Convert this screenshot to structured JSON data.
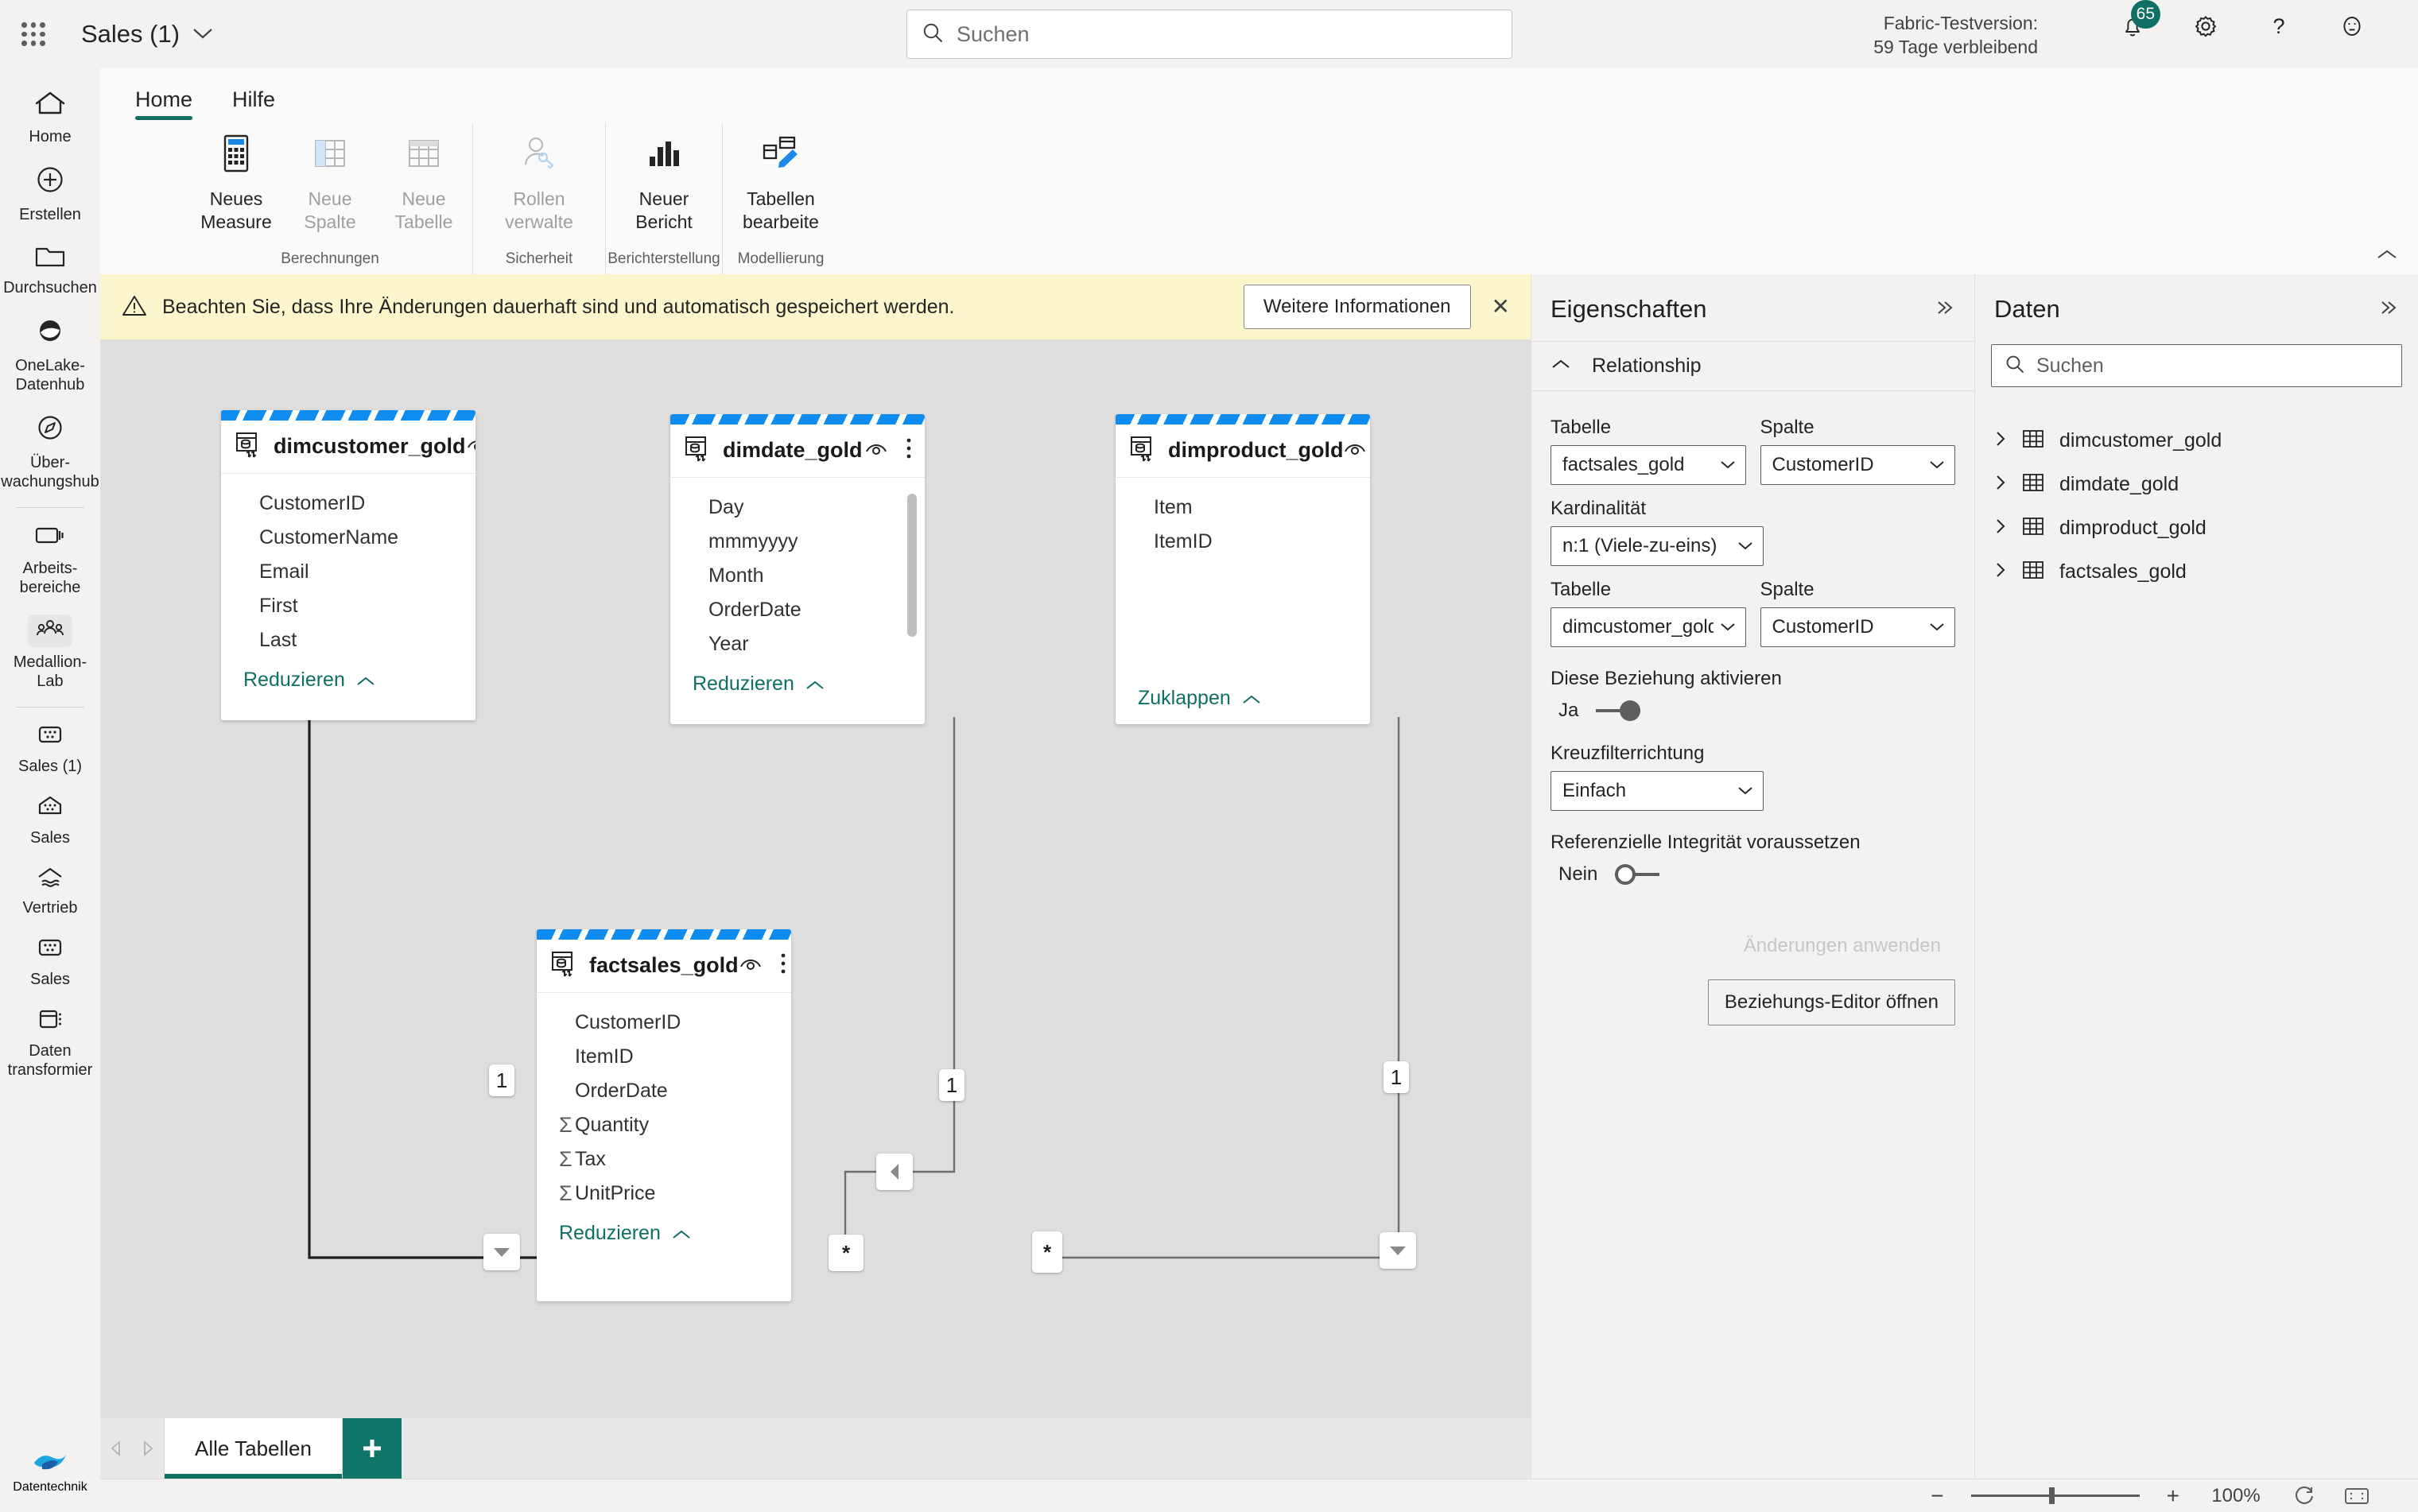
{
  "topbar": {
    "app_title": "Sales (1)",
    "waffle_icon": "app-launcher-icon",
    "title_chevron": "chevron-down-icon",
    "search": {
      "placeholder": "Suchen",
      "value": "",
      "icon": "search-icon"
    },
    "trial_line1": "Fabric-Testversion:",
    "trial_line2": "59 Tage verbleibend",
    "notifications": {
      "icon": "bell-icon",
      "badge": "65"
    },
    "settings_icon": "gear-icon",
    "help_icon": "question-mark-icon",
    "feedback_icon": "smiley-face-icon"
  },
  "sidebar": {
    "items": [
      {
        "label": "Home",
        "icon": "home-icon"
      },
      {
        "label": "Erstellen",
        "icon": "plus-circle-icon"
      },
      {
        "label": "Durchsuchen",
        "icon": "folder-icon"
      },
      {
        "label": "OneLake-\nDatenhub",
        "icon": "onelake-icon"
      },
      {
        "label": "Über-\nwachungshub",
        "icon": "compass-icon"
      },
      {
        "label": "Arbeits-\nbereiche",
        "icon": "workspaces-icon"
      },
      {
        "label": "Medallion-\nLab",
        "icon": "people-group-icon"
      },
      {
        "label": "Sales (1)",
        "icon": "semantic-model-icon"
      },
      {
        "label": "Sales",
        "icon": "lakehouse-icon"
      },
      {
        "label": "Vertrieb",
        "icon": "warehouse-icon"
      },
      {
        "label": "Sales",
        "icon": "semantic-model-icon"
      },
      {
        "label": "Daten\ntransformier",
        "icon": "dataflow-icon"
      }
    ],
    "bottom": {
      "label": "Datentechnik",
      "icon": "data-engineering-icon"
    }
  },
  "ribbon": {
    "tabs": [
      {
        "label": "Home",
        "active": true
      },
      {
        "label": "Hilfe",
        "active": false
      }
    ],
    "groups": [
      {
        "label": "Berechnungen",
        "buttons": [
          {
            "label": "Neues\nMeasure",
            "icon": "new-measure-icon",
            "disabled": false
          },
          {
            "label": "Neue\nSpalte",
            "icon": "new-column-icon",
            "disabled": true
          },
          {
            "label": "Neue\nTabelle",
            "icon": "new-table-icon",
            "disabled": true
          }
        ]
      },
      {
        "label": "Sicherheit",
        "buttons": [
          {
            "label": "Rollen\nverwalte",
            "icon": "manage-roles-icon",
            "disabled": true
          }
        ]
      },
      {
        "label": "Berichterstellung",
        "buttons": [
          {
            "label": "Neuer\nBericht",
            "icon": "new-report-icon",
            "disabled": false
          }
        ]
      },
      {
        "label": "Modellierung",
        "buttons": [
          {
            "label": "Tabellen\nbearbeite",
            "icon": "edit-tables-icon",
            "disabled": false
          }
        ]
      }
    ],
    "collapse_icon": "chevron-up-icon"
  },
  "banner": {
    "icon": "warning-triangle-icon",
    "text": "Beachten Sie, dass Ihre Änderungen dauerhaft sind und automatisch gespeichert werden.",
    "button": "Weitere Informationen",
    "close_icon": "close-icon"
  },
  "canvas": {
    "tables": [
      {
        "name": "dimcustomer_gold",
        "icon": "table-sync-icon",
        "eye_icon": "eye-icon",
        "more_icon": "more-vertical-icon",
        "fields": [
          {
            "name": "CustomerID",
            "agg": false
          },
          {
            "name": "CustomerName",
            "agg": false
          },
          {
            "name": "Email",
            "agg": false
          },
          {
            "name": "First",
            "agg": false
          },
          {
            "name": "Last",
            "agg": false
          }
        ],
        "collapse_label": "Reduzieren",
        "collapse_icon": "chevron-up-icon",
        "scrollbar": false
      },
      {
        "name": "dimdate_gold",
        "icon": "table-sync-icon",
        "eye_icon": "eye-icon",
        "more_icon": "more-vertical-icon",
        "fields": [
          {
            "name": "Day",
            "agg": false
          },
          {
            "name": "mmmyyyy",
            "agg": false
          },
          {
            "name": "Month",
            "agg": false
          },
          {
            "name": "OrderDate",
            "agg": false
          },
          {
            "name": "Year",
            "agg": false
          }
        ],
        "collapse_label": "Reduzieren",
        "collapse_icon": "chevron-up-icon",
        "scrollbar": true
      },
      {
        "name": "dimproduct_gold",
        "icon": "table-sync-icon",
        "eye_icon": "eye-icon",
        "more_icon": "more-vertical-icon",
        "fields": [
          {
            "name": "Item",
            "agg": false
          },
          {
            "name": "ItemID",
            "agg": false
          }
        ],
        "collapse_label": "Zuklappen",
        "collapse_icon": "chevron-up-icon",
        "scrollbar": false
      },
      {
        "name": "factsales_gold",
        "icon": "table-sync-icon",
        "eye_icon": "eye-icon",
        "more_icon": "more-vertical-icon",
        "fields": [
          {
            "name": "CustomerID",
            "agg": false
          },
          {
            "name": "ItemID",
            "agg": false
          },
          {
            "name": "OrderDate",
            "agg": false
          },
          {
            "name": "Quantity",
            "agg": true
          },
          {
            "name": "Tax",
            "agg": true
          },
          {
            "name": "UnitPrice",
            "agg": true
          }
        ],
        "collapse_label": "Reduzieren",
        "collapse_icon": "chevron-up-icon",
        "scrollbar": false
      }
    ],
    "relationships": [
      {
        "from": "dimcustomer_gold",
        "to": "factsales_gold",
        "one": "1",
        "many": "*",
        "direction_icon": "filter-down-icon",
        "selected": true
      },
      {
        "from": "dimdate_gold",
        "to": "factsales_gold",
        "one": "1",
        "many": "*",
        "direction_icon": "filter-left-icon",
        "selected": false
      },
      {
        "from": "dimproduct_gold",
        "to": "factsales_gold",
        "one": "1",
        "many": "*",
        "direction_icon": "filter-down-icon",
        "selected": false
      }
    ]
  },
  "properties": {
    "title": "Eigenschaften",
    "collapse_icon": "chevrons-right-icon",
    "section": {
      "label": "Relationship",
      "chevron": "chevron-up-icon"
    },
    "from_table_label": "Tabelle",
    "from_table_value": "factsales_gold",
    "from_column_label": "Spalte",
    "from_column_value": "CustomerID",
    "cardinality_label": "Kardinalität",
    "cardinality_value": "n:1 (Viele-zu-eins)",
    "to_table_label": "Tabelle",
    "to_table_value": "dimcustomer_gold",
    "to_column_label": "Spalte",
    "to_column_value": "CustomerID",
    "active_label": "Diese Beziehung aktivieren",
    "active_value": "Ja",
    "crossfilter_label": "Kreuzfilterrichtung",
    "crossfilter_value": "Einfach",
    "integrity_label": "Referenzielle Integrität voraussetzen",
    "integrity_value": "Nein",
    "apply_button": "Änderungen anwenden",
    "editor_button": "Beziehungs-Editor öffnen"
  },
  "data_panel": {
    "title": "Daten",
    "collapse_icon": "chevrons-right-icon",
    "search": {
      "placeholder": "Suchen",
      "value": "",
      "icon": "search-icon"
    },
    "tables": [
      {
        "name": "dimcustomer_gold",
        "icon": "table-icon",
        "expand_icon": "chevron-right-icon"
      },
      {
        "name": "dimdate_gold",
        "icon": "table-icon",
        "expand_icon": "chevron-right-icon"
      },
      {
        "name": "dimproduct_gold",
        "icon": "table-icon",
        "expand_icon": "chevron-right-icon"
      },
      {
        "name": "factsales_gold",
        "icon": "table-icon",
        "expand_icon": "chevron-right-icon"
      }
    ]
  },
  "bottombar": {
    "prev_icon": "triangle-left-icon",
    "next_icon": "triangle-right-icon",
    "tab_label": "Alle Tabellen",
    "add_icon": "plus-icon"
  },
  "statusbar": {
    "zoom_out": "−",
    "zoom_in": "+",
    "zoom_level": "100%",
    "reset_icon": "refresh-icon",
    "fit_icon": "fit-to-screen-icon"
  },
  "colors": {
    "accent_teal": "#0f6f64",
    "stripe_blue": "#0f8cf0",
    "banner_yellow": "#fdf6cd",
    "canvas_gray": "#e0dedc"
  }
}
